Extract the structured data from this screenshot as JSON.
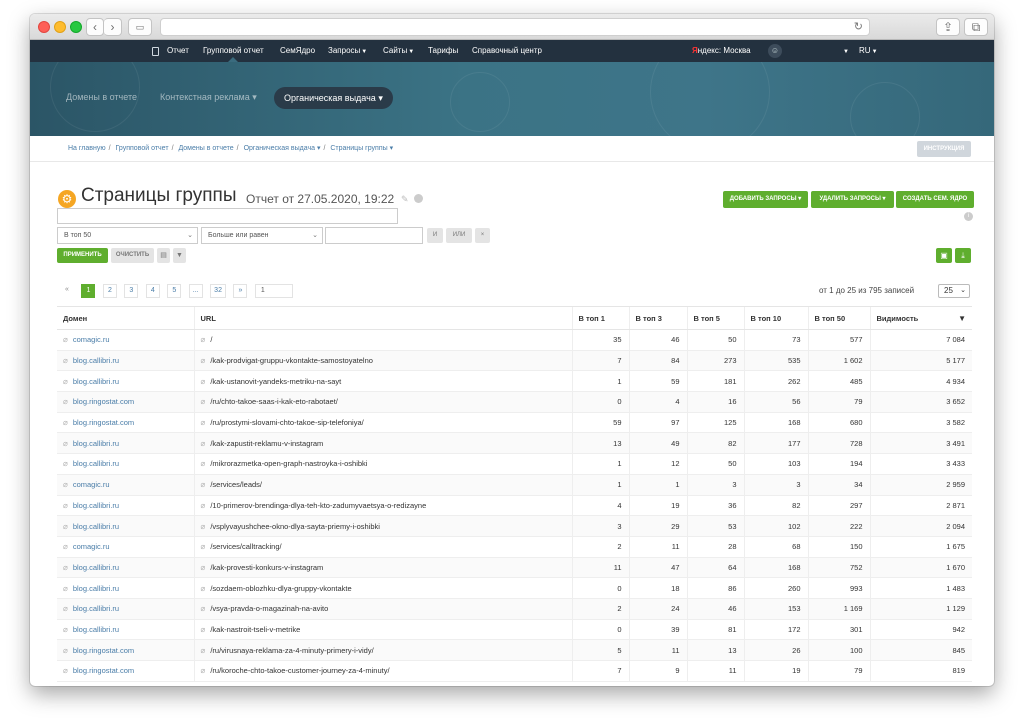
{
  "topnav": {
    "items": [
      {
        "label": "Отчет"
      },
      {
        "label": "Групповой отчет"
      },
      {
        "label": "СемЯдро"
      },
      {
        "label": "Запросы"
      },
      {
        "label": "Сайты"
      },
      {
        "label": "Тарифы"
      },
      {
        "label": "Справочный центр"
      }
    ],
    "region_brand": "Я",
    "region_text": "ндекс: Москва",
    "language": "RU"
  },
  "banner": {
    "tabs": [
      "Домены в отчете",
      "Контекстная реклама",
      "Органическая выдача"
    ]
  },
  "breadcrumbs": {
    "items": [
      "На главную",
      "Групповой отчет",
      "Домены в отчете",
      "Органическая выдача",
      "Страницы группы"
    ],
    "instruction_label": "ИНСТРУКЦИЯ"
  },
  "page": {
    "title": "Страницы группы",
    "subtitle": "Отчет от 27.05.2020, 19:22"
  },
  "actions": {
    "add_label": "ДОБАВИТЬ ЗАПРОСЫ",
    "delete_label": "УДАЛИТЬ ЗАПРОСЫ",
    "create_label": "СОЗДАТЬ СЕМ. ЯДРО"
  },
  "filters": {
    "search_value": "",
    "top_select": "В топ 50",
    "condition_select": "Больше или равен",
    "value": "",
    "and_label": "И",
    "or_label": "ИЛИ",
    "remove_label": "×",
    "apply_label": "ПРИМЕНИТЬ",
    "clear_label": "ОЧИСТИТЬ"
  },
  "pagination": {
    "first": "«",
    "pages": [
      "1",
      "2",
      "3",
      "4",
      "5",
      "...",
      "32"
    ],
    "next": "»",
    "jump_value": "1",
    "records_text": "от 1 до 25 из 795 записей",
    "page_size": "25"
  },
  "table": {
    "headers": [
      "Домен",
      "URL",
      "В топ 1",
      "В топ 3",
      "В топ 5",
      "В топ 10",
      "В топ 50",
      "Видимость"
    ],
    "rows": [
      {
        "domain": "comagic.ru",
        "url": "/",
        "t1": "35",
        "t3": "46",
        "t5": "50",
        "t10": "73",
        "t50": "577",
        "vis": "7 084"
      },
      {
        "domain": "blog.callibri.ru",
        "url": "/kak-prodvigat-gruppu-vkontakte-samostoyatelno",
        "t1": "7",
        "t3": "84",
        "t5": "273",
        "t10": "535",
        "t50": "1 602",
        "vis": "5 177"
      },
      {
        "domain": "blog.callibri.ru",
        "url": "/kak-ustanovit-yandeks-metriku-na-sayt",
        "t1": "1",
        "t3": "59",
        "t5": "181",
        "t10": "262",
        "t50": "485",
        "vis": "4 934"
      },
      {
        "domain": "blog.ringostat.com",
        "url": "/ru/chto-takoe-saas-i-kak-eto-rabotaet/",
        "t1": "0",
        "t3": "4",
        "t5": "16",
        "t10": "56",
        "t50": "79",
        "vis": "3 652"
      },
      {
        "domain": "blog.ringostat.com",
        "url": "/ru/prostymi-slovami-chto-takoe-sip-telefoniya/",
        "t1": "59",
        "t3": "97",
        "t5": "125",
        "t10": "168",
        "t50": "680",
        "vis": "3 582"
      },
      {
        "domain": "blog.callibri.ru",
        "url": "/kak-zapustit-reklamu-v-instagram",
        "t1": "13",
        "t3": "49",
        "t5": "82",
        "t10": "177",
        "t50": "728",
        "vis": "3 491"
      },
      {
        "domain": "blog.callibri.ru",
        "url": "/mikrorazmetka-open-graph-nastroyka-i-oshibki",
        "t1": "1",
        "t3": "12",
        "t5": "50",
        "t10": "103",
        "t50": "194",
        "vis": "3 433"
      },
      {
        "domain": "comagic.ru",
        "url": "/services/leads/",
        "t1": "1",
        "t3": "1",
        "t5": "3",
        "t10": "3",
        "t50": "34",
        "vis": "2 959"
      },
      {
        "domain": "blog.callibri.ru",
        "url": "/10-primerov-brendinga-dlya-teh-kto-zadumyvaetsya-o-redizayne",
        "t1": "4",
        "t3": "19",
        "t5": "36",
        "t10": "82",
        "t50": "297",
        "vis": "2 871"
      },
      {
        "domain": "blog.callibri.ru",
        "url": "/vsplyvayushchee-okno-dlya-sayta-priemy-i-oshibki",
        "t1": "3",
        "t3": "29",
        "t5": "53",
        "t10": "102",
        "t50": "222",
        "vis": "2 094"
      },
      {
        "domain": "comagic.ru",
        "url": "/services/calltracking/",
        "t1": "2",
        "t3": "11",
        "t5": "28",
        "t10": "68",
        "t50": "150",
        "vis": "1 675"
      },
      {
        "domain": "blog.callibri.ru",
        "url": "/kak-provesti-konkurs-v-instagram",
        "t1": "11",
        "t3": "47",
        "t5": "64",
        "t10": "168",
        "t50": "752",
        "vis": "1 670"
      },
      {
        "domain": "blog.callibri.ru",
        "url": "/sozdaem-oblozhku-dlya-gruppy-vkontakte",
        "t1": "0",
        "t3": "18",
        "t5": "86",
        "t10": "260",
        "t50": "993",
        "vis": "1 483"
      },
      {
        "domain": "blog.callibri.ru",
        "url": "/vsya-pravda-o-magazinah-na-avito",
        "t1": "2",
        "t3": "24",
        "t5": "46",
        "t10": "153",
        "t50": "1 169",
        "vis": "1 129"
      },
      {
        "domain": "blog.callibri.ru",
        "url": "/kak-nastroit-tseli-v-metrike",
        "t1": "0",
        "t3": "39",
        "t5": "81",
        "t10": "172",
        "t50": "301",
        "vis": "942"
      },
      {
        "domain": "blog.ringostat.com",
        "url": "/ru/virusnaya-reklama-za-4-minuty-primery-i-vidy/",
        "t1": "5",
        "t3": "11",
        "t5": "13",
        "t10": "26",
        "t50": "100",
        "vis": "845"
      },
      {
        "domain": "blog.ringostat.com",
        "url": "/ru/koroche-chto-takoe-customer-journey-za-4-minuty/",
        "t1": "7",
        "t3": "9",
        "t5": "11",
        "t10": "19",
        "t50": "79",
        "vis": "819"
      }
    ]
  },
  "icons": {
    "attachment": "paperclip-icon",
    "title": "gear-icon",
    "sort": "chevron-down-icon"
  },
  "colors": {
    "accent_green": "#5fae2e",
    "nav_bg": "#23313f",
    "link_blue": "#4a7da8",
    "title_icon": "#f5a623"
  }
}
